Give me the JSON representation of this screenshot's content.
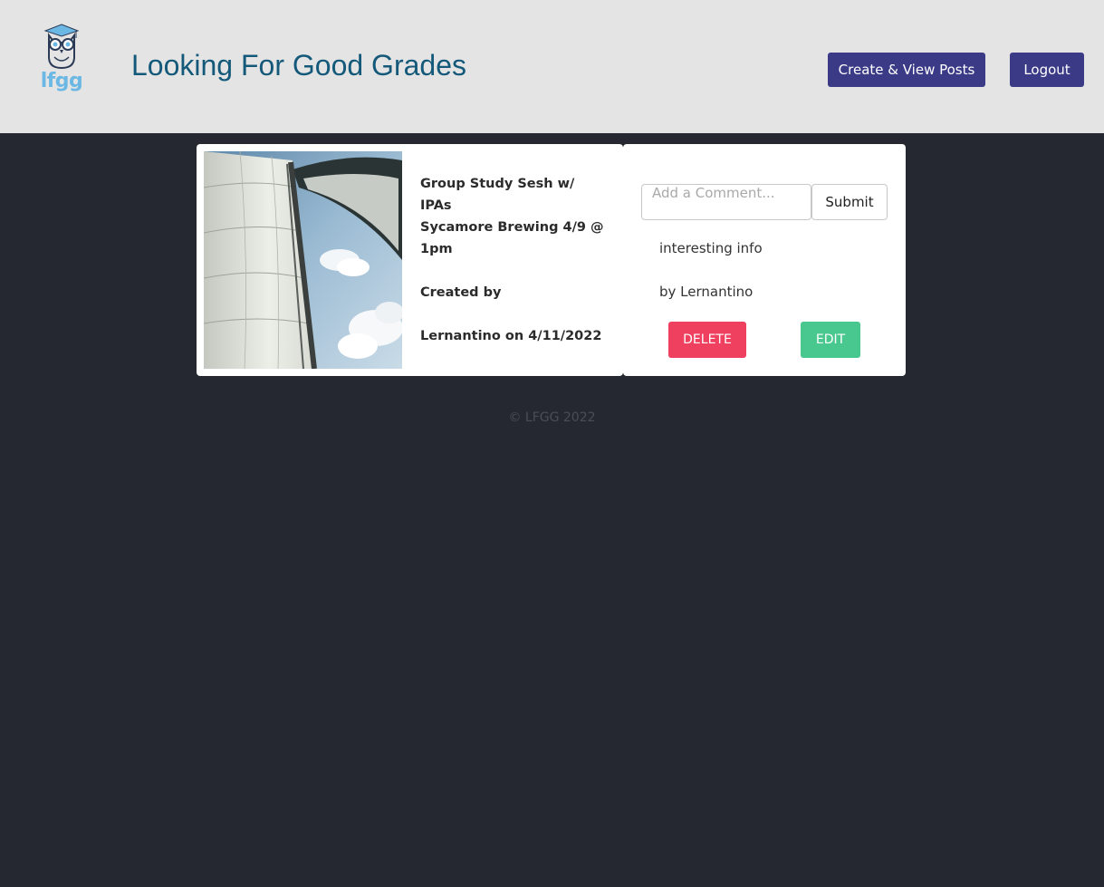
{
  "header": {
    "logo_text": "lfgg",
    "title": "Looking For Good Grades",
    "nav": {
      "create_label": "Create & View Posts",
      "logout_label": "Logout"
    }
  },
  "post": {
    "title": "Group Study Sesh w/ IPAs",
    "location": "Sycamore Brewing 4/9 @ 1pm",
    "created_by_label": "Created by",
    "author_date": "Lernantino on 4/11/2022"
  },
  "comments": {
    "placeholder": "Add a Comment...",
    "submit_label": "Submit",
    "items": [
      {
        "text": "interesting info",
        "author": "by Lernantino"
      }
    ],
    "delete_label": "DELETE",
    "edit_label": "EDIT"
  },
  "footer": {
    "copyright": "© LFGG 2022"
  },
  "colors": {
    "header_bg": "#e4e4e4",
    "page_bg": "#252831",
    "title": "#14597a",
    "nav_button": "#3b3a87",
    "delete": "#ef4060",
    "edit": "#48c78e",
    "logo_accent": "#6cb8e4"
  },
  "icons": {
    "logo": "owl-graduate-icon"
  }
}
